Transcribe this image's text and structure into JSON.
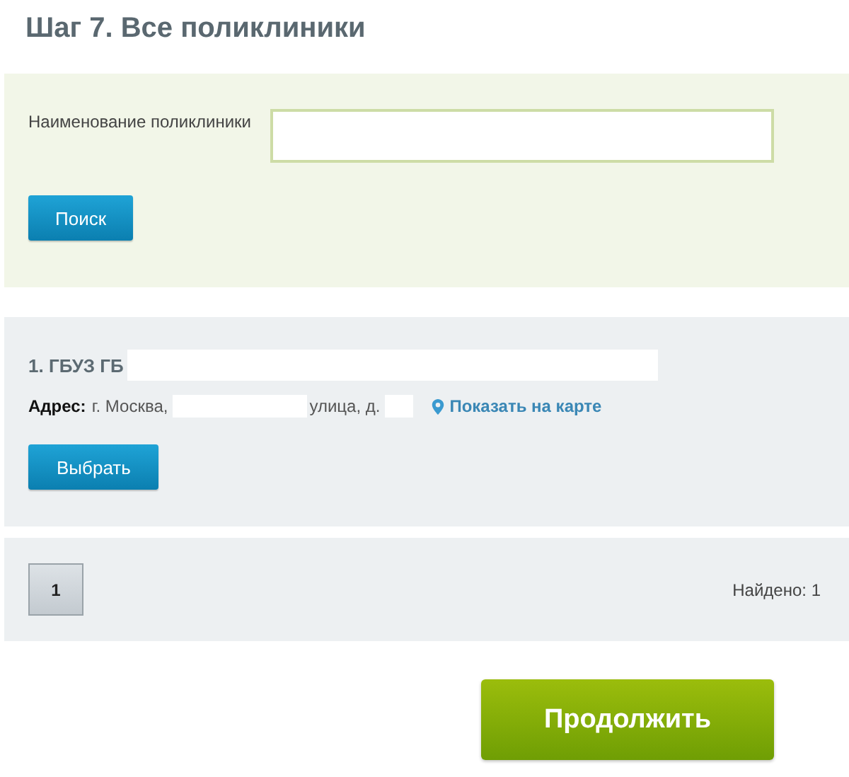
{
  "title": "Шаг 7. Все поликлиники",
  "search": {
    "label": "Наименование поликлиники",
    "button": "Поиск"
  },
  "results": [
    {
      "name": "1. ГБУЗ ГБ",
      "address_label": "Адрес:",
      "address_city": "г. Москва,",
      "address_street": "улица, д.",
      "map_link": "Показать на карте",
      "button": "Выбрать"
    }
  ],
  "pagination": {
    "pages": [
      {
        "label": "1",
        "selected": true
      }
    ],
    "found": "Найдено: 1"
  },
  "continue_button": "Продолжить"
}
